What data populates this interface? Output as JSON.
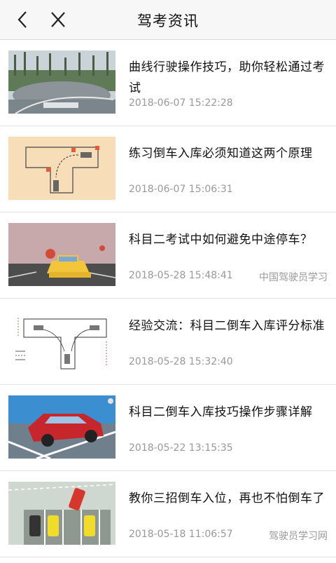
{
  "header": {
    "title": "驾考资讯",
    "back_icon": "chevron-left-icon",
    "close_icon": "close-icon"
  },
  "articles": [
    {
      "title": "曲线行驶操作技巧，助你轻松通过考试",
      "date": "2018-06-07 15:22:28",
      "source": ""
    },
    {
      "title": "练习倒车入库必须知道这两个原理",
      "date": "2018-06-07 15:06:31",
      "source": ""
    },
    {
      "title": "科目二考试中如何避免中途停车？",
      "date": "2018-05-28 15:48:41",
      "source": "中国驾驶员学习"
    },
    {
      "title": "经验交流：科目二倒车入库评分标准",
      "date": "2018-05-28 15:32:40",
      "source": ""
    },
    {
      "title": "科目二倒车入库技巧操作步骤详解",
      "date": "2018-05-22 13:15:35",
      "source": ""
    },
    {
      "title": "教你三招倒车入位，再也不怕倒车了",
      "date": "2018-05-18 11:06:57",
      "source": "驾驶员学习网"
    }
  ]
}
